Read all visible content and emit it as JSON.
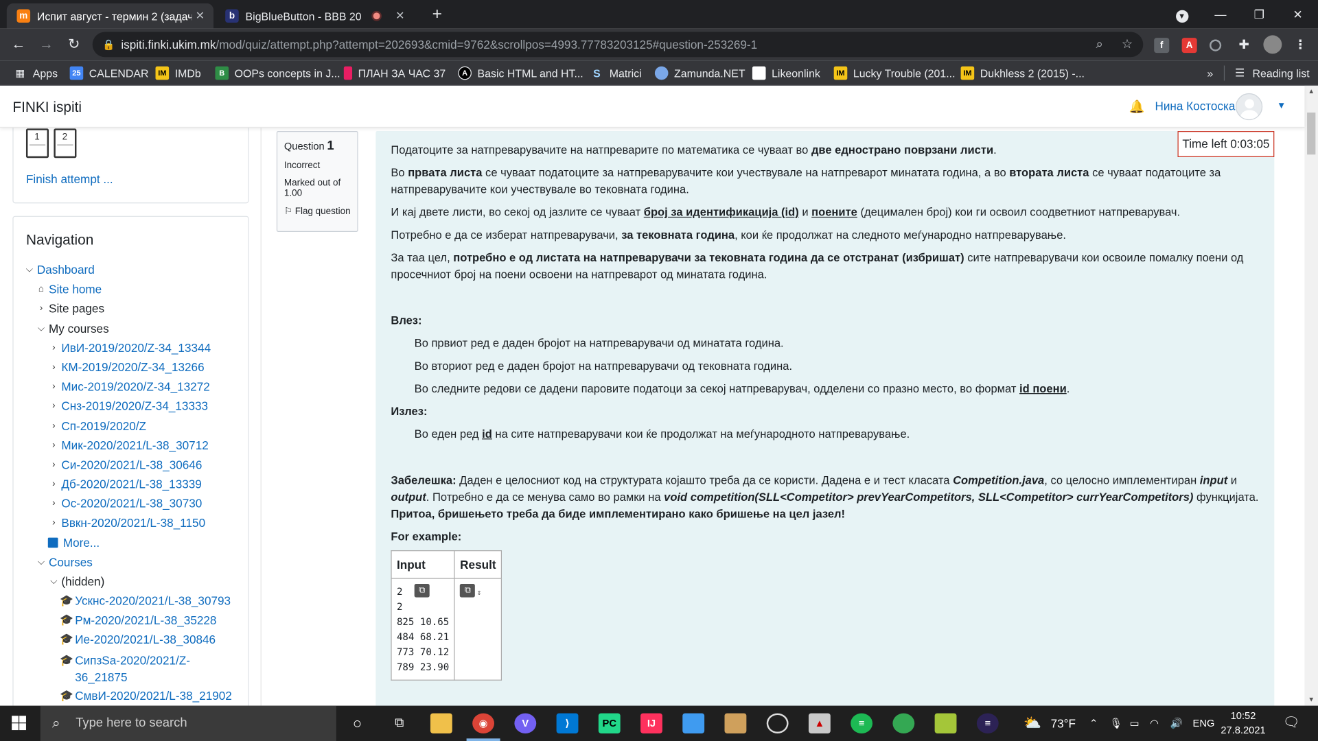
{
  "browser": {
    "tabs": [
      {
        "title": "Испит август - термин 2 (задача",
        "favicon": "m",
        "active": true
      },
      {
        "title": "BigBlueButton - BBB 20",
        "favicon": "b",
        "active": false
      }
    ],
    "url_domain": "ispiti.finki.ukim.mk",
    "url_path": "/mod/quiz/attempt.php?attempt=202693&cmid=9762&scrollpos=4993.77783203125#question-253269-1",
    "bookmarks": [
      {
        "label": "Apps",
        "icon": "apps-grid-icon"
      },
      {
        "label": "CALENDAR",
        "icon": "calendar-icon"
      },
      {
        "label": "IMDb",
        "icon": "imdb-icon"
      },
      {
        "label": "OOPs concepts in J...",
        "icon": "bookmark-icon"
      },
      {
        "label": "ПЛАН ЗА ЧАС 37",
        "icon": "bookmark-icon"
      },
      {
        "label": "Basic HTML and HT...",
        "icon": "bookmark-icon"
      },
      {
        "label": "Matrici",
        "icon": "bookmark-icon"
      },
      {
        "label": "Zamunda.NET",
        "icon": "bookmark-icon"
      },
      {
        "label": "Likeonlink",
        "icon": "bookmark-icon"
      },
      {
        "label": "Lucky Trouble (201...",
        "icon": "imdb-icon"
      },
      {
        "label": "Dukhless 2 (2015) -...",
        "icon": "imdb-icon"
      }
    ],
    "more_bookmarks": "»",
    "reading_list": "Reading list"
  },
  "moodle": {
    "brand": "FINKI ispiti",
    "user_name": "Нина Костоска",
    "quiz_nav": {
      "questions": [
        "1",
        "2"
      ],
      "finish": "Finish attempt ..."
    },
    "navigation": {
      "title": "Navigation",
      "dashboard": "Dashboard",
      "site_home": "Site home",
      "site_pages": "Site pages",
      "my_courses": "My courses",
      "courses_list": [
        "ИвИ-2019/2020/Z-34_13344",
        "КМ-2019/2020/Z-34_13266",
        "Мис-2019/2020/Z-34_13272",
        "Снз-2019/2020/Z-34_13333",
        "Сп-2019/2020/Z",
        "Мик-2020/2021/L-38_30712",
        "Си-2020/2021/L-38_30646",
        "Дб-2020/2021/L-38_13339",
        "Ос-2020/2021/L-38_30730",
        "Ввкн-2020/2021/L-38_1150"
      ],
      "more": "More...",
      "courses": "Courses",
      "hidden": "(hidden)",
      "hidden_courses": [
        "Ускнс-2020/2021/L-38_30793",
        "Рм-2020/2021/L-38_35228",
        "Ие-2020/2021/L-38_30846",
        "СипзЅа-2020/2021/Z-36_21875",
        "СмвИ-2020/2021/L-38_21902"
      ]
    },
    "question_info": {
      "label": "Question",
      "number": "1",
      "status": "Incorrect",
      "marked": "Marked out of 1.00",
      "flag": "Flag question"
    },
    "timer": "Time left 0:03:05",
    "question": {
      "p1_a": "Податоците за натпреварувачите на натпреварите по математика се чуваат во ",
      "p1_b": "две еднострано поврзани листи",
      "p1_c": ".",
      "p2_a": "Во ",
      "p2_b": "првата листа",
      "p2_c": " се чуваат податоците за натпреварувачите кои учествувале на натпреварот минатата година, а во ",
      "p2_d": "втората листа",
      "p2_e": " се чуваат податоците за натпреварувачите кои учествувале во тековната година.",
      "p3_a": "И кај двете листи, во секој од јазлите се чуваат ",
      "p3_b": "број за идентификација (id)",
      "p3_c": " и ",
      "p3_d": "поените",
      "p3_e": " (децимален број) кои ги освоил соодветниот натпреварувач.",
      "p4_a": "Потребно е да се изберат натпреварувачи, ",
      "p4_b": "за тековната година",
      "p4_c": ", кои ќе продолжат на следното меѓународно натпреварување.",
      "p5_a": "За таа цел, ",
      "p5_b": "потребно е од листата на натпреварувачи за тековната година да се отстранат (избришат)",
      "p5_c": " сите натпреварувачи кои освоиле помалку поени од просечниот број на поени освоени на натпреварот од минатата година.",
      "input_title": "Влез:",
      "input_1": "Во првиот ред е даден бројот на натпреварувачи од минатата година.",
      "input_2": "Во вториот ред е даден бројот на натпреварувачи од тековната година.",
      "input_3_a": "Во следните редови се дадени паровите податоци за секој натпреварувач, одделени со празно место, во формат ",
      "input_3_b": "id поени",
      "input_3_c": ".",
      "output_title": "Излез:",
      "output_1_a": "Во еден ред ",
      "output_1_b": "id",
      "output_1_c": " на сите натпреварувачи кои ќе продолжат на меѓународното натпреварување.",
      "note_a": "Забелешка:",
      "note_b": " Даден е целосниот код на структурата којашто треба да се користи. Дадена е и тест класата ",
      "note_c": "Competition.java",
      "note_d": ", со целосно имплементиран ",
      "note_e": "input",
      "note_f": " и ",
      "note_g": "output",
      "note_h": ". Потребно е да се менува само во рамки на ",
      "note_i": "void competition(SLL<Competitor> prevYearCompetitors, SLL<Competitor> currYearCompetitors)",
      "note_j": " функцијата. ",
      "note_k": "Притоа, бришењето треба да биде имплементирано како бришење на цел јазел!",
      "example_title": "For example:",
      "table_headers": [
        "Input",
        "Result"
      ],
      "table_input": [
        "2",
        "2",
        "825 10.65",
        "484 68.21",
        "773 70.12",
        "789 23.90"
      ]
    }
  },
  "taskbar": {
    "search_placeholder": "Type here to search",
    "weather": "73°F",
    "language": "ENG",
    "time": "10:52",
    "date": "27.8.2021"
  },
  "colors": {
    "moodle_blue": "#0f6cbf",
    "question_bg": "#e7f3f5",
    "timer_border": "#ca3120"
  }
}
